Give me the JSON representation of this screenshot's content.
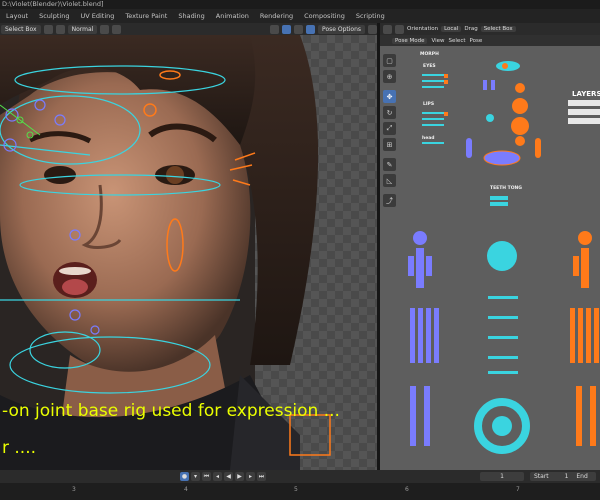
{
  "window": {
    "title": "D:\\Violet(Blender)\\Violet.blend]"
  },
  "workspaces": [
    "Layout",
    "Sculpting",
    "UV Editing",
    "Texture Paint",
    "Shading",
    "Animation",
    "Rendering",
    "Compositing",
    "Scripting"
  ],
  "viewport_left": {
    "header": {
      "select_box": "Select Box",
      "normal": "Normal",
      "pose_options": "Pose Options"
    },
    "caption_line1": "-on joint base rig used for  expression ...",
    "caption_line2": "r ....",
    "colors": {
      "caption": "#eaff00",
      "rig_cyan": "#3ad4e0",
      "rig_orange": "#ff7a1a",
      "rig_purple": "#7a7cff"
    }
  },
  "right_editor": {
    "header": {
      "orientation_label": "Orientation",
      "orientation_value": "Local",
      "drag_label": "Drag",
      "select_box": "Select Box"
    },
    "sub_header": {
      "mode": "Pose Mode",
      "view": "View",
      "select": "Select",
      "pose": "Pose"
    },
    "rig_labels": {
      "morph": "MORPH",
      "eyes": "EYES",
      "lips": "LIPS",
      "head": "head",
      "teeth_tong": "TEETH  TONG",
      "layers": "LAYERS"
    }
  },
  "timeline": {
    "current_frame": "1",
    "start_label": "Start",
    "start_value": "1",
    "end_label": "End",
    "ticks": [
      "3",
      "4",
      "5",
      "6",
      "7"
    ]
  }
}
